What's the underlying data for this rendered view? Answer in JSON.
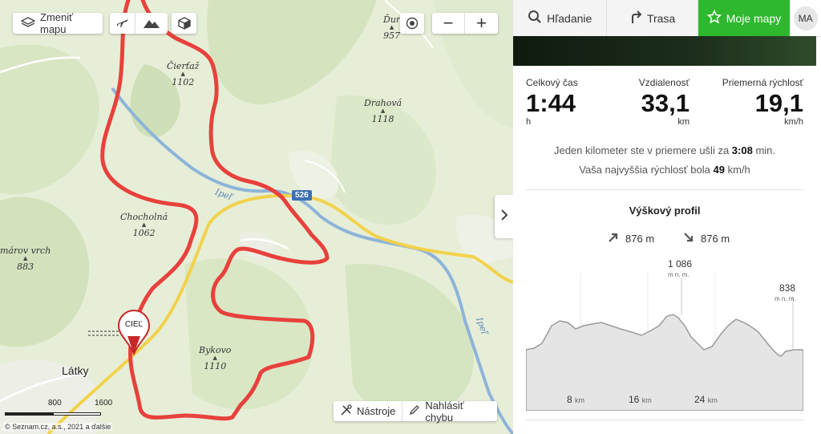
{
  "map": {
    "change_map_label": "Zmeniť mapu",
    "layer_icons": [
      "plane-icon",
      "mountain-icon",
      "cube-icon"
    ],
    "zoom": {
      "minus": "−",
      "plus": "+"
    },
    "peaks": [
      {
        "name": "Čierťaž",
        "elev": "1102"
      },
      {
        "name": "Drahová",
        "elev": "1118"
      },
      {
        "name": "Chocholná",
        "elev": "1062"
      },
      {
        "name": "márov vrch",
        "elev": "883"
      },
      {
        "name": "Bykovo",
        "elev": "1110"
      },
      {
        "name": "Ďur",
        "elev": "957"
      }
    ],
    "river_labels": [
      "Ipeľ",
      "Ipeľ"
    ],
    "road_badge": "526",
    "town": "Látky",
    "finish_marker": "CIEĽ",
    "scale": {
      "a": "800",
      "b": "1600"
    },
    "attribution": "© Seznam.cz, a.s., 2021 a ďalšie",
    "tools_label": "Nástroje",
    "report_label": "Nahlásiť chybu",
    "route_color": "#e8413c"
  },
  "panel": {
    "tabs": {
      "search": "Hľadanie",
      "route": "Trasa",
      "mymaps": "Moje mapy",
      "avatar": "MA"
    },
    "accent": "#2eb82e",
    "stats": {
      "time_label": "Celkový čas",
      "time_value": "1:44",
      "time_unit": "h",
      "dist_label": "Vzdialenosť",
      "dist_value": "33,1",
      "dist_unit": "km",
      "speed_label": "Priemerná rýchlosť",
      "speed_value": "19,1",
      "speed_unit": "km/h"
    },
    "info": {
      "line1_pre": "Jeden kilometer ste v priemere ušli za",
      "line1_val": "3:08",
      "line1_post": "min.",
      "line2_pre": "Vaša najvyššia rýchlosť bola",
      "line2_val": "49",
      "line2_post": "km/h"
    },
    "profile": {
      "title": "Výškový profil",
      "ascent": "876 m",
      "descent": "876 m",
      "max_value": "1 086",
      "max_unit": "m n. m.",
      "end_value": "838",
      "end_unit": "m n. m.",
      "km_ticks": [
        {
          "v": "8",
          "u": "km"
        },
        {
          "v": "16",
          "u": "km"
        },
        {
          "v": "24",
          "u": "km"
        }
      ]
    }
  }
}
